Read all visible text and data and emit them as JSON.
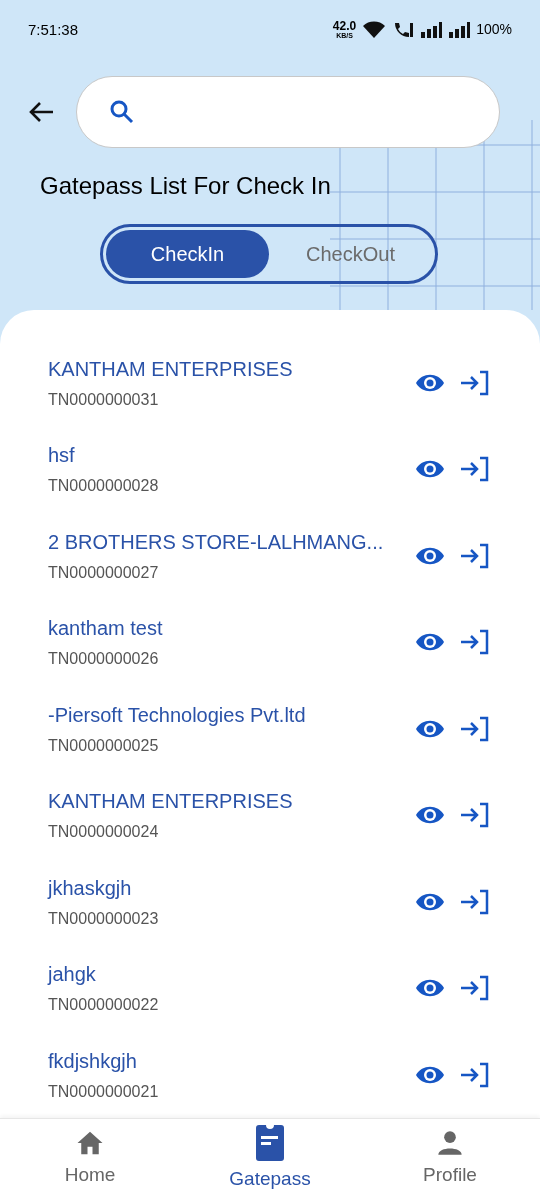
{
  "status_bar": {
    "time": "7:51:38",
    "speed": "42.0",
    "speed_unit": "KB/S",
    "battery": "100%"
  },
  "title": "Gatepass List For Check In",
  "tabs": [
    {
      "label": "CheckIn",
      "selected": true
    },
    {
      "label": "CheckOut",
      "selected": false
    }
  ],
  "gatepasses": [
    {
      "name": "KANTHAM ENTERPRISES",
      "number": "TN0000000031"
    },
    {
      "name": "hsf",
      "number": "TN0000000028"
    },
    {
      "name": "2 BROTHERS STORE-LALHMANG...",
      "number": "TN0000000027"
    },
    {
      "name": "kantham test",
      "number": "TN0000000026"
    },
    {
      "name": "-Piersoft Technologies Pvt.ltd",
      "number": "TN0000000025"
    },
    {
      "name": "KANTHAM ENTERPRISES",
      "number": "TN0000000024"
    },
    {
      "name": "jkhaskgjh",
      "number": "TN0000000023"
    },
    {
      "name": "jahgk",
      "number": "TN0000000022"
    },
    {
      "name": "fkdjshkgjh",
      "number": "TN0000000021"
    }
  ],
  "bottom_nav": [
    {
      "kind": "home",
      "label": "Home",
      "selected": false
    },
    {
      "kind": "gatepass",
      "label": "Gatepass",
      "selected": true
    },
    {
      "kind": "profile",
      "label": "Profile",
      "selected": false
    }
  ]
}
